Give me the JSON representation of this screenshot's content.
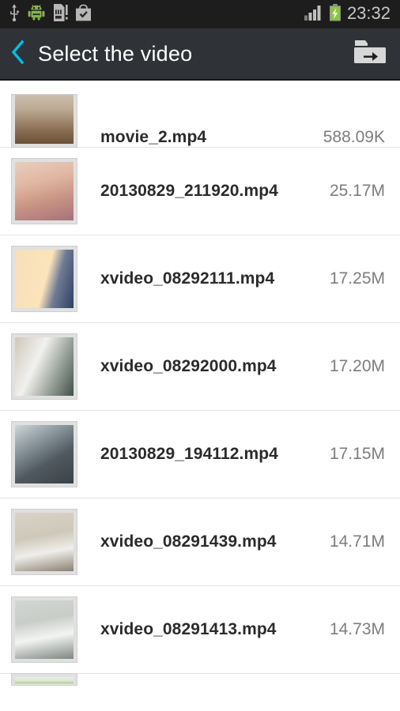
{
  "status_bar": {
    "icons": [
      {
        "name": "usb-icon",
        "label": "USB connected"
      },
      {
        "name": "android-debug-icon",
        "label": "USB debugging"
      },
      {
        "name": "sd-card-icon",
        "label": "SD card"
      },
      {
        "name": "play-store-icon",
        "label": "Play Store update"
      }
    ],
    "signal": {
      "name": "signal-bars-icon",
      "bars": 4
    },
    "battery": {
      "name": "battery-charging-icon",
      "charging": true,
      "color": "#8cc63e"
    },
    "time": "23:32",
    "background": "#1d1d1d",
    "text_color": "#c8c8c8"
  },
  "action_bar": {
    "back_label": "‹",
    "title": "Select the video",
    "folder_button_name": "folder-forward-icon",
    "background": "#2f3337",
    "accent": "#00bfe8",
    "title_color": "#ffffff"
  },
  "list": {
    "columns": [
      "thumbnail",
      "filename",
      "size"
    ],
    "items": [
      {
        "filename": "movie_2.mp4",
        "size": "588.09K",
        "thumb": "t0",
        "clipped": "top"
      },
      {
        "filename": "20130829_211920.mp4",
        "size": "25.17M",
        "thumb": "t1"
      },
      {
        "filename": "xvideo_08292111.mp4",
        "size": "17.25M",
        "thumb": "t2"
      },
      {
        "filename": "xvideo_08292000.mp4",
        "size": "17.20M",
        "thumb": "t3"
      },
      {
        "filename": "20130829_194112.mp4",
        "size": "17.15M",
        "thumb": "t4"
      },
      {
        "filename": "xvideo_08291439.mp4",
        "size": "14.71M",
        "thumb": "t5"
      },
      {
        "filename": "xvideo_08291413.mp4",
        "size": "14.73M",
        "thumb": "t6"
      },
      {
        "filename": "",
        "size": "",
        "thumb": "t7",
        "clipped": "bottom"
      }
    ],
    "divider_color": "#e4e4e4",
    "filename_color": "#2b2b2b",
    "size_color": "#7d7d7d",
    "background": "#ffffff"
  }
}
